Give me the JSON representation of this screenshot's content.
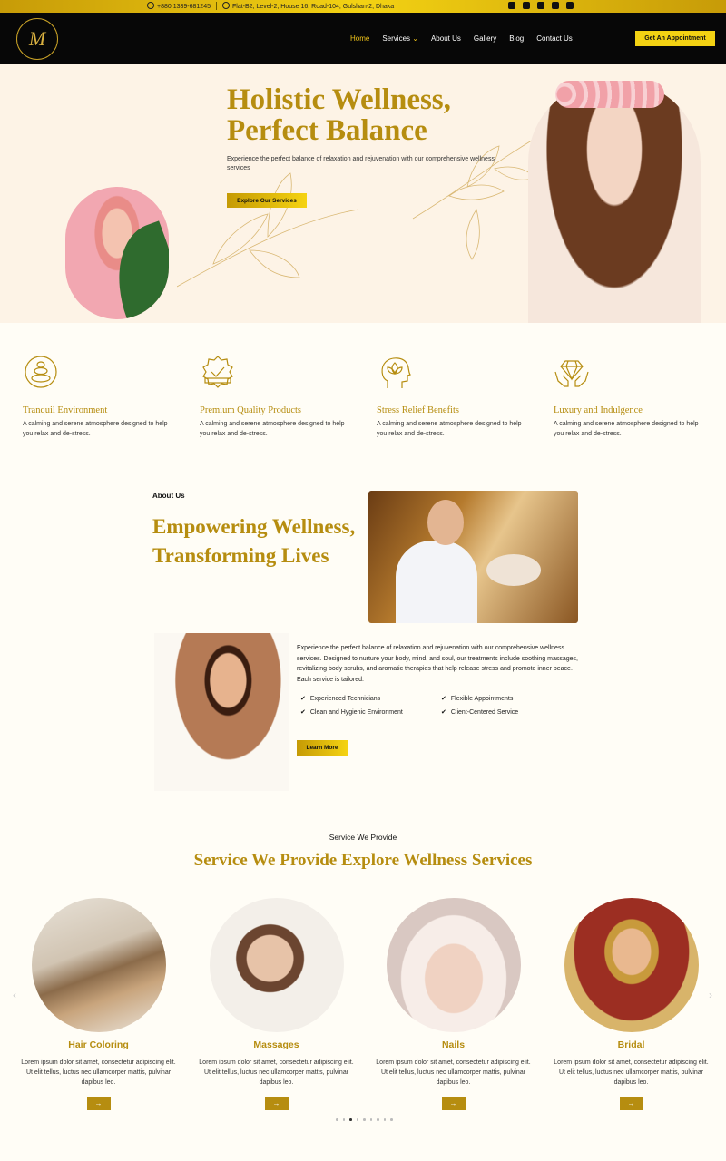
{
  "topbar": {
    "phone": "+880 1339-681245",
    "address": "Flat-B2, Level-2, House 16, Road-104, Gulshan-2, Dhaka",
    "socials": [
      "facebook-icon",
      "instagram-icon",
      "linkedin-icon",
      "youtube-icon",
      "tiktok-icon"
    ]
  },
  "nav": {
    "items": [
      "Home",
      "Services",
      "About Us",
      "Gallery",
      "Blog",
      "Contact Us"
    ],
    "cta": "Get An Appointment"
  },
  "hero": {
    "title_line1": "Holistic Wellness,",
    "title_line2": "Perfect Balance",
    "subtitle": "Experience the perfect balance of relaxation and rejuvenation with our comprehensive wellness services",
    "button": "Explore Our Services"
  },
  "features": [
    {
      "icon": "zen-stones-icon",
      "title": "Tranquil Environment",
      "text": "A calming and serene atmosphere designed to help you relax and de-stress."
    },
    {
      "icon": "premium-badge-icon",
      "title": "Premium Quality Products",
      "text": "A calming and serene atmosphere designed to help you relax and de-stress."
    },
    {
      "icon": "mind-lotus-icon",
      "title": "Stress Relief Benefits",
      "text": "A calming and serene atmosphere designed to help you relax and de-stress."
    },
    {
      "icon": "hands-diamond-icon",
      "title": "Luxury and Indulgence",
      "text": "A calming and serene atmosphere designed to help you relax and de-stress."
    }
  ],
  "about": {
    "label": "About Us",
    "title_line1": "Empowering Wellness,",
    "title_line2": "Transforming Lives",
    "text": "Experience the perfect balance of relaxation and rejuvenation with our comprehensive wellness services. Designed to nurture your body, mind, and soul, our treatments include soothing massages, revitalizing body scrubs, and aromatic therapies that help release stress and promote inner peace. Each service is tailored.",
    "checks": [
      "Experienced Technicians",
      "Flexible Appointments",
      "Clean and Hygienic Environment",
      "Client-Centered Service"
    ],
    "button": "Learn More"
  },
  "services": {
    "eyebrow": "Service We Provide",
    "title": "Service We Provide Explore Wellness Services",
    "items": [
      {
        "name": "Hair Coloring",
        "text": "Lorem ipsum dolor sit amet, consectetur adipiscing elit. Ut elit tellus, luctus nec ullamcorper mattis, pulvinar dapibus leo."
      },
      {
        "name": "Massages",
        "text": "Lorem ipsum dolor sit amet, consectetur adipiscing elit. Ut elit tellus, luctus nec ullamcorper mattis, pulvinar dapibus leo."
      },
      {
        "name": "Nails",
        "text": "Lorem ipsum dolor sit amet, consectetur adipiscing elit. Ut elit tellus, luctus nec ullamcorper mattis, pulvinar dapibus leo."
      },
      {
        "name": "Bridal",
        "text": "Lorem ipsum dolor sit amet, consectetur adipiscing elit. Ut elit tellus, luctus nec ullamcorper mattis, pulvinar dapibus leo."
      }
    ],
    "arrow_label": "→",
    "prev_label": "‹",
    "next_label": "›"
  },
  "colors": {
    "gold": "#b68d10",
    "accent_yellow": "#f3d213",
    "nav_bg": "#070707",
    "hero_bg": "#fdf3e6"
  }
}
